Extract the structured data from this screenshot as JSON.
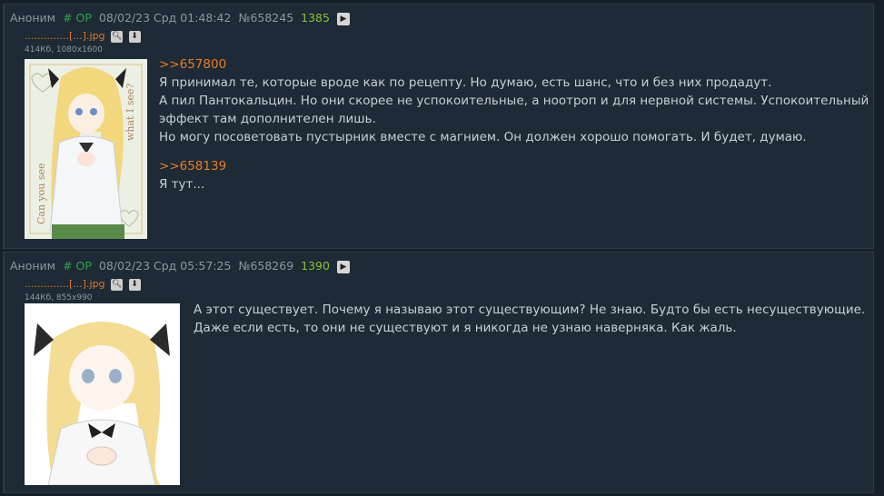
{
  "posts": [
    {
      "author": "Аноним",
      "op_tag": "# OP",
      "datetime": "08/02/23 Срд 01:48:42",
      "number": "№658245",
      "replies": "1385",
      "file": {
        "name": "..............[...].jpg",
        "info": "414Кб, 1080x1600"
      },
      "body": {
        "quote1": ">>657800",
        "lines1": [
          "Я принимал те, которые вроде как по рецепту. Но думаю, есть шанс, что и без них продадут.",
          "А пил Пантокальцин. Но они скорее не успокоительные, а ноотроп и для нервной системы. Успокоительный",
          "эффект там дополнителен лишь.",
          "Но могу посоветовать пустырник вместе с магнием. Он должен хорошо помогать. И будет, думаю."
        ],
        "quote2": ">>658139",
        "lines2": [
          "Я тут..."
        ]
      }
    },
    {
      "author": "Аноним",
      "op_tag": "# OP",
      "datetime": "08/02/23 Срд 05:57:25",
      "number": "№658269",
      "replies": "1390",
      "file": {
        "name": "..............[...].jpg",
        "info": "144Кб, 855x990"
      },
      "body": {
        "lines": [
          "А этот существует. Почему я называю этот существующим? Не знаю. Будто бы есть несуществующие.",
          "Даже если есть, то они не существуют и я никогда не узнаю наверняка. Как жаль."
        ]
      }
    }
  ],
  "image_text": {
    "left": "Can you see",
    "right": "what I see?"
  },
  "icons": {
    "play": "play-icon",
    "search": "search-icon",
    "download": "download-icon"
  }
}
